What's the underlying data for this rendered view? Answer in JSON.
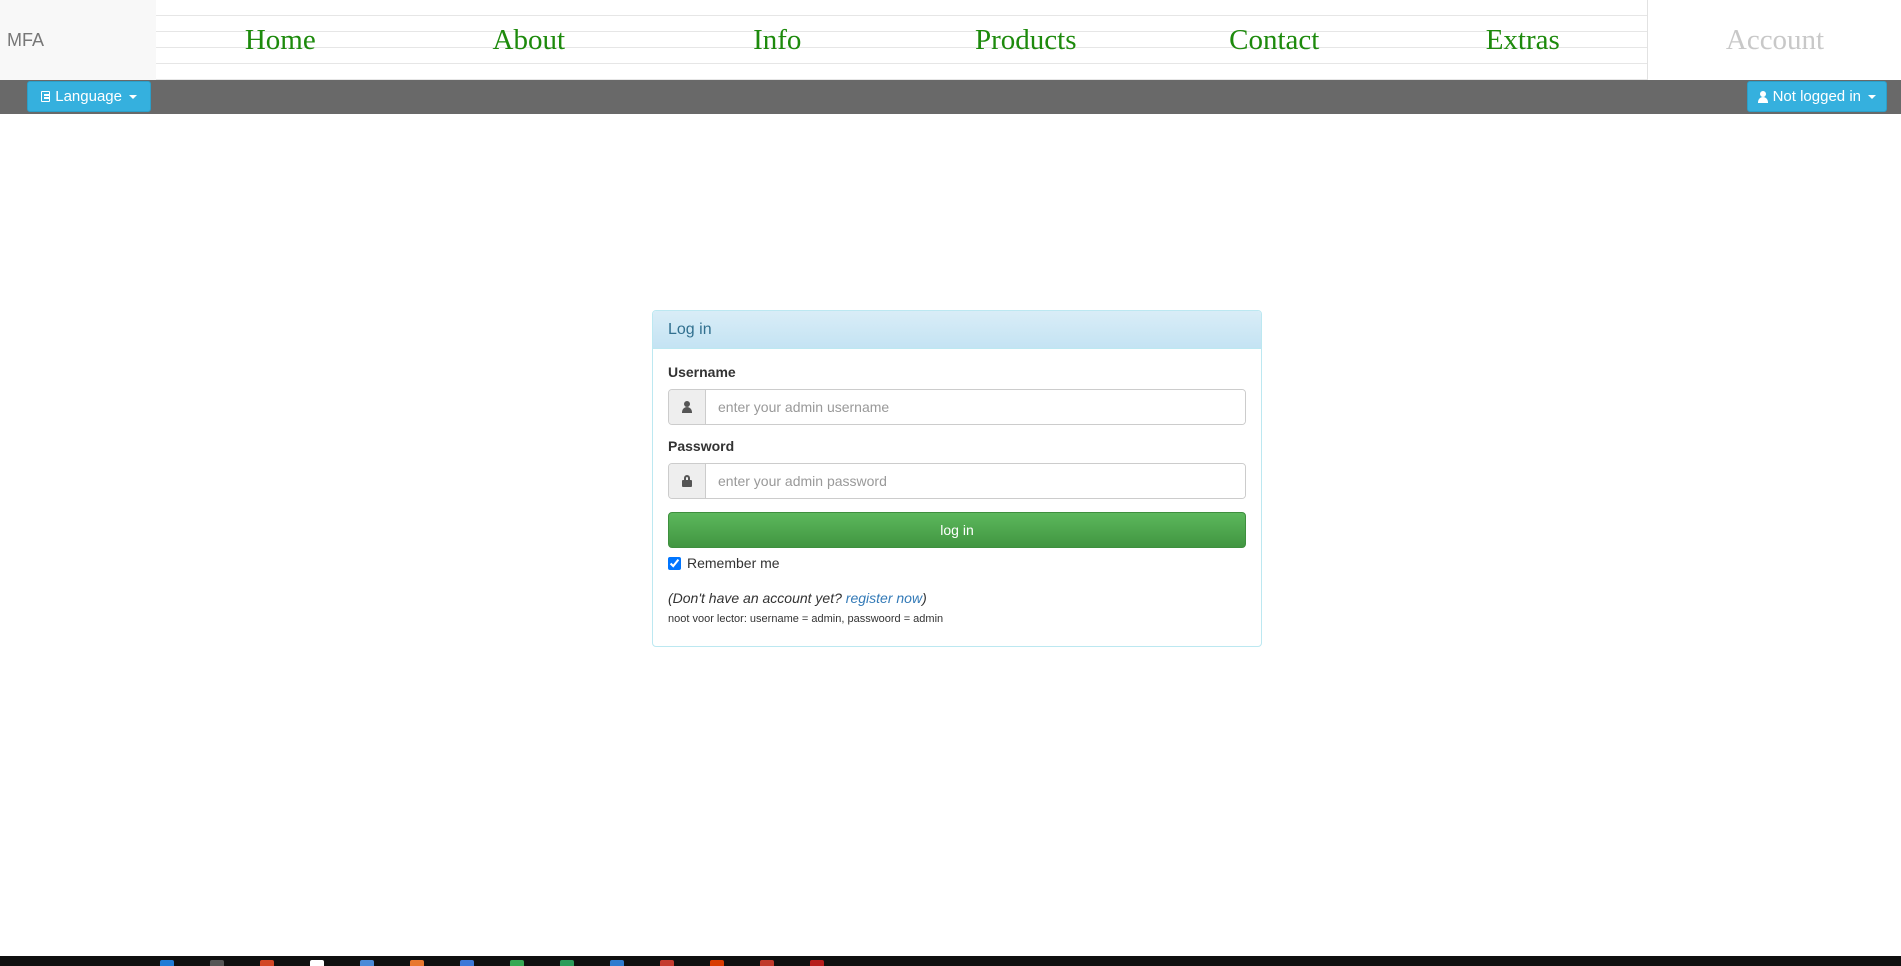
{
  "brand": "MFA",
  "nav": {
    "items": [
      "Home",
      "About",
      "Info",
      "Products",
      "Contact",
      "Extras"
    ],
    "account": "Account"
  },
  "toolbar": {
    "language": "Language",
    "user_status": "Not logged in"
  },
  "login": {
    "heading": "Log in",
    "username_label": "Username",
    "username_placeholder": "enter your admin username",
    "password_label": "Password",
    "password_placeholder": "enter your admin password",
    "submit": "log in",
    "remember_label": "Remember me",
    "remember_checked": true,
    "register_prompt": "(Don't have an account yet? ",
    "register_link": "register now",
    "register_close": ")",
    "note": "noot voor lector: username = admin, passwoord = admin"
  },
  "taskbar": {
    "icon_colors": [
      "#1f7bd6",
      "#555555",
      "#d24726",
      "#ffffff",
      "#4a8ad8",
      "#e8772e",
      "#3b78d8",
      "#35a853",
      "#2b9c5a",
      "#2e7bcf",
      "#c43b2f",
      "#d83b01",
      "#c0392b",
      "#b71c1c"
    ]
  }
}
